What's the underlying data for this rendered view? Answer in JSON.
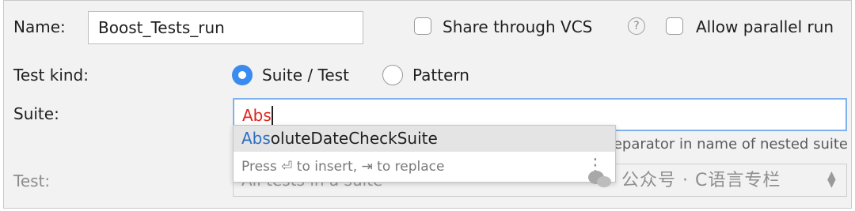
{
  "name_label": "Name:",
  "name_value": "Boost_Tests_run",
  "share_vcs_label": "Share through VCS",
  "help_glyph": "?",
  "allow_parallel_label": "Allow parallel run",
  "test_kind_label": "Test kind:",
  "radio_suite_test_label": "Suite / Test",
  "radio_pattern_label": "Pattern",
  "suite_label": "Suite:",
  "suite_value": "Abs",
  "test_label": "Test:",
  "test_placeholder": "All tests in a suite",
  "separator_hint": "separator in name of nested suite",
  "completion": {
    "item_match": "Abs",
    "item_rest": "oluteDateCheckSuite",
    "hint": "Press ⏎ to insert, ⇥ to replace",
    "more_glyph": "⋮"
  },
  "watermark": "公众号 · C语言专栏",
  "colors": {
    "accent_blue": "#3a8bef",
    "focus_border": "#7fb1ec",
    "error_text": "#e0241b",
    "match_text": "#2f6fc1"
  }
}
